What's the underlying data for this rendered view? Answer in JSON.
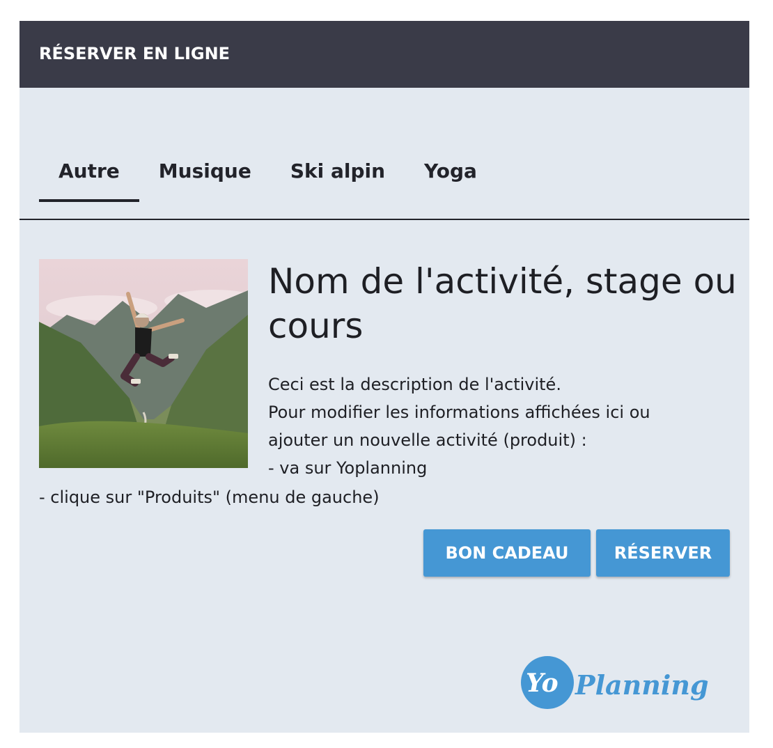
{
  "header": {
    "title": "RÉSERVER EN LIGNE"
  },
  "tabs": [
    {
      "label": "Autre",
      "active": true
    },
    {
      "label": "Musique",
      "active": false
    },
    {
      "label": "Ski alpin",
      "active": false
    },
    {
      "label": "Yoga",
      "active": false
    }
  ],
  "activity": {
    "title": "Nom de l'activité, stage ou cours",
    "description_lines": [
      "Ceci est la description de l'activité.",
      "Pour modifier les informations affichées ici ou",
      "ajouter un nouvelle activité (produit) :",
      "- va sur Yoplanning",
      "- clique sur \"Produits\" (menu de gauche)"
    ],
    "image_alt": "person-jumping-mountains"
  },
  "buttons": {
    "gift": "BON CADEAU",
    "book": "RÉSERVER"
  },
  "logo": {
    "part1": "Yo",
    "part2": "Planning"
  },
  "colors": {
    "header_bg": "#3a3b48",
    "panel_bg": "#e3e9f0",
    "accent": "#4597d4",
    "text": "#1e1f24"
  }
}
